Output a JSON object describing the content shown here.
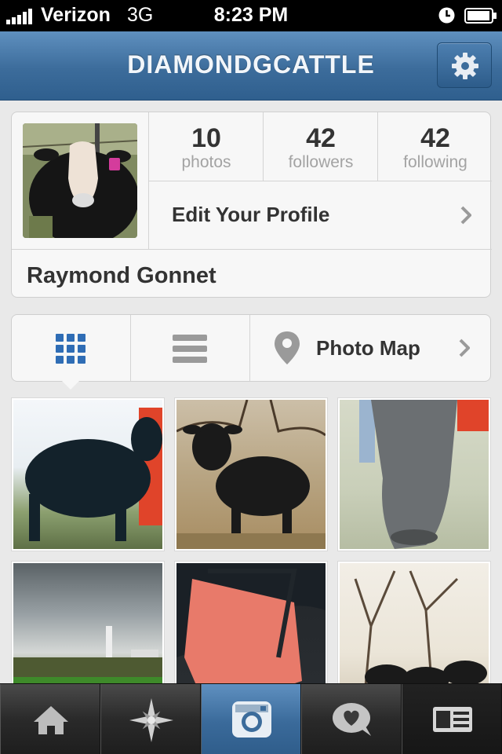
{
  "status_bar": {
    "carrier": "Verizon",
    "network": "3G",
    "time": "8:23 PM"
  },
  "nav": {
    "title": "DIAMONDGCATTLE",
    "settings_icon": "gear-icon"
  },
  "profile": {
    "stats": [
      {
        "number": "10",
        "label": "photos"
      },
      {
        "number": "42",
        "label": "followers"
      },
      {
        "number": "42",
        "label": "following"
      }
    ],
    "edit_label": "Edit Your Profile",
    "full_name": "Raymond Gonnet"
  },
  "view_toggle": {
    "grid_icon": "grid-icon",
    "list_icon": "list-icon",
    "map_icon": "map-pin-icon",
    "map_label": "Photo Map",
    "selected": "grid"
  },
  "photos": [
    {
      "subject": "black calf beside red trailer"
    },
    {
      "subject": "black calf in field"
    },
    {
      "subject": "gray calf leg close-up"
    },
    {
      "subject": "stormy sky over farm"
    },
    {
      "subject": "pink ear tag"
    },
    {
      "subject": "cattle under trees"
    }
  ],
  "tab_bar": {
    "tabs": [
      "home-icon",
      "explore-star-icon",
      "camera-icon",
      "news-heart-icon",
      "profile-card-icon"
    ],
    "active": "profile-card-icon"
  },
  "colors": {
    "nav_blue": "#3c6c9b",
    "grid_blue": "#2f6db5",
    "tab_dark": "#2a2a2a"
  }
}
